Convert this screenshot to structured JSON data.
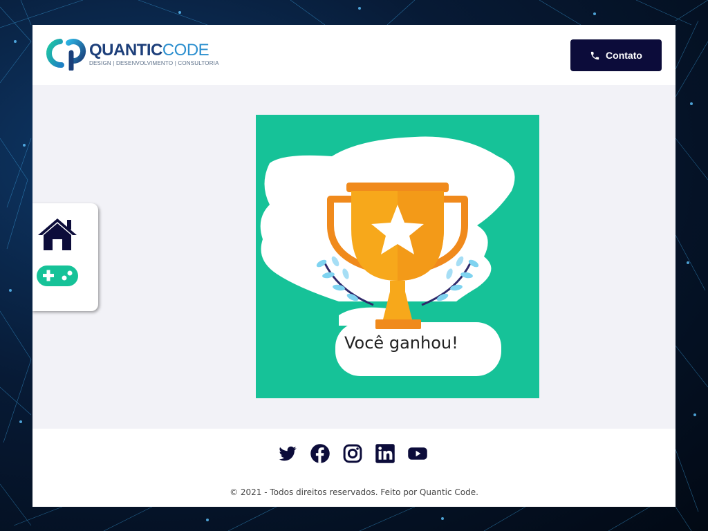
{
  "header": {
    "logo": {
      "word_part1": "QUANTIC",
      "word_part2": "CODE",
      "tagline": "DESIGN | DESENVOLVIMENTO | CONSULTORIA"
    },
    "contact_button": {
      "label": "Contato",
      "icon": "phone-icon"
    }
  },
  "sidebar": {
    "items": [
      {
        "icon": "home-icon"
      },
      {
        "icon": "gamepad-icon"
      }
    ]
  },
  "main": {
    "card": {
      "message": "Você ganhou!",
      "icon": "trophy-icon"
    }
  },
  "footer": {
    "social": [
      "twitter-icon",
      "facebook-icon",
      "instagram-icon",
      "linkedin-icon",
      "youtube-icon"
    ],
    "copyright": "© 2021 - Todos direitos reservados. Feito por Quantic Code."
  },
  "colors": {
    "navy": "#0c0c3a",
    "teal": "#16c298",
    "trophy_gold": "#f7a81b",
    "trophy_orange": "#f08a1c",
    "page_bg": "#f2f2f7"
  }
}
